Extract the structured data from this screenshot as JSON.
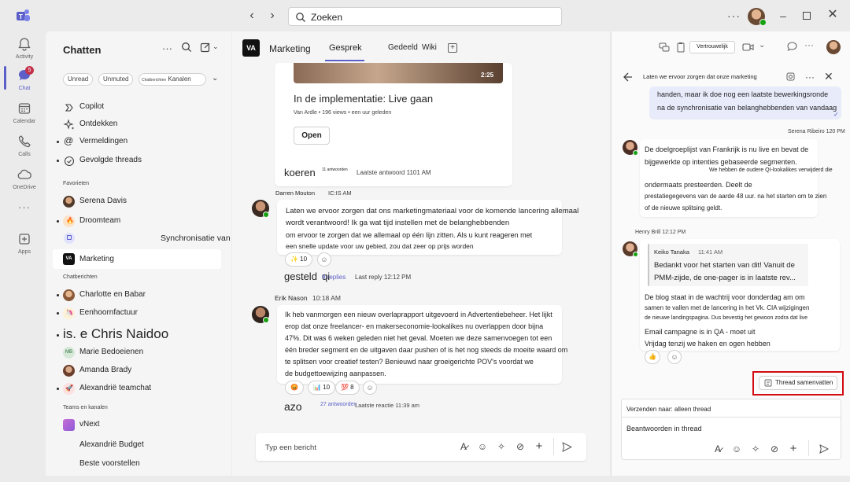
{
  "titlebar": {
    "search_placeholder": "Zoeken",
    "more": "···"
  },
  "rail": {
    "items": [
      {
        "label": "Activity",
        "icon": "bell-icon"
      },
      {
        "label": "Chat",
        "icon": "chat-icon",
        "badge": "5"
      },
      {
        "label": "Calendar",
        "icon": "calendar-icon"
      },
      {
        "label": "Calls",
        "icon": "phone-icon"
      },
      {
        "label": "OneDrive",
        "icon": "cloud-icon"
      },
      {
        "label": "···",
        "icon": "more-icon"
      },
      {
        "label": "Apps",
        "icon": "apps-icon"
      }
    ]
  },
  "chatlist": {
    "title": "Chatten",
    "more": "···",
    "filters": [
      "Unread",
      "Unmuted",
      "Chatberichten",
      "Kanalen"
    ],
    "top_items": [
      {
        "label": "Copilot",
        "icon": "copilot-icon"
      },
      {
        "label": "Ontdekken",
        "icon": "sparkle-icon"
      },
      {
        "label": "Vermeldingen",
        "icon": "at-icon"
      },
      {
        "label": "Gevolgde threads",
        "icon": "thread-icon"
      }
    ],
    "favorites_header": "Favorieten",
    "favorites": [
      {
        "label": "Serena Davis"
      },
      {
        "label": "Droomteam"
      },
      {
        "label": "Synchronisatie van marketingteam"
      },
      {
        "label": "Marketing"
      }
    ],
    "chats_header": "Chatberichten",
    "chats": [
      {
        "label": "Charlotte en Babar"
      },
      {
        "label": "Eenhoornfactuur"
      },
      {
        "label": "is. e Chris Naidoo"
      },
      {
        "label": "Marie Bedoeienen",
        "initials": "MB"
      },
      {
        "label": "Amanda Brady"
      },
      {
        "label": "Alexandrië teamchat"
      }
    ],
    "teams_header": "Teams en kanalen",
    "teams": [
      {
        "label": "vNext"
      },
      {
        "label": "Alexandrië Budget"
      },
      {
        "label": "Beste voorstellen"
      }
    ]
  },
  "main": {
    "team_logo": "VA",
    "team_name": "Marketing",
    "tabs": [
      "Gesprek",
      "Gedeeld",
      "Wiki"
    ],
    "card": {
      "duration": "2:25",
      "title": "In de implementatie: Live gaan",
      "subtitle": "Van Ardle • 196 views • een uur geleden",
      "button": "Open"
    },
    "reply1": {
      "name": "koeren",
      "count": "11 antwoorden",
      "last": "Laatste antwoord 1101 AM"
    },
    "post2": {
      "author": "Darren Mouton",
      "time": "IC:IS AM",
      "lines": [
        "Laten we ervoor zorgen dat ons marketingmateriaal voor de komende lancering allemaal",
        "wordt verantwoord! Ik ga wat tijd instellen met de belanghebbenden",
        "om ervoor te zorgen dat we allemaal op één lijn zitten. Als u kunt reageren met",
        "een snelle update voor uw gebied, zou dat zeer op prijs worden"
      ],
      "reaction": "✨ 10"
    },
    "reply2": {
      "name": "gesteld",
      "extra": "qi",
      "count": "9 replies",
      "last": "Last reply 12:12 PM"
    },
    "post3": {
      "author": "Erik Nason",
      "time": "10:18 AM",
      "lines": [
        "Ik heb vanmorgen een nieuw overlaprapport uitgevoerd in Advertentiebeheer. Het lijkt",
        "erop dat onze freelancer- en makerseconomie-lookalikes nu overlappen door bijna",
        "47%. Dit was 6 weken geleden niet het geval. Moeten we deze samenvoegen tot een",
        "één breder segment en de uitgaven daar pushen of is het nog steeds de moeite waard om",
        "te splitsen voor creatief testen? Benieuwd naar groeigerichte POV's voordat we",
        "de budgettoewijzing aanpassen."
      ],
      "reactions": [
        "😡",
        "📊 10",
        "💯 8"
      ]
    },
    "reply3": {
      "name": "azo",
      "count": "27 antwoorden",
      "last": "Laatste reactie 11:39 am"
    },
    "compose_placeholder": "Typ een bericht"
  },
  "thread": {
    "title": "Laten we ervoor zorgen dat onze marketing",
    "more": "···",
    "my_msg_lines": [
      "handen, maar ik doe nog een laatste bewerkingsronde",
      "na de synchronisatie van belanghebbenden van vandaag"
    ],
    "msg1_meta": "Serena Ribeiro 120 PM",
    "msg1_lines": [
      "De doelgroeplijst van Frankrijk is nu live en bevat de",
      "bijgewerkte op intenties gebaseerde segmenten.",
      "We hebben de oudere QI-lookalikes verwijderd die",
      "ondermaats presteerden. Deelt de",
      "prestatiegegevens van de aarde 48 uur. na het starten om te zien",
      "of de nieuwe splitsing geldt."
    ],
    "msg2_meta": "Henry Brill 12:12 PM",
    "quote_author": "Keiko Tanaka",
    "quote_time": "11:41 AM",
    "quote_lines": [
      "Bedankt voor het starten van dit! Vanuit de",
      "PMM-zijde, de one-pager is in laatste rev..."
    ],
    "msg2_lines": [
      "De blog staat in de wachtrij voor donderdag am om",
      "samen te vallen met de lancering in het Vk. CIA wijzigingen",
      "de nieuwe landingspagina.  Dus bevestig het gewoon zodra dat live",
      "Email campagne is in QA - moet uit",
      "Vrijdag tenzij we haken en ogen hebben"
    ],
    "msg2_reaction": "👍",
    "summarize_button": "Thread samenvatten",
    "send_to": "Verzenden naar: alleen thread",
    "reply_placeholder": "Beantwoorden in thread"
  },
  "colors": {
    "accent": "#5b5fc7",
    "highlight": "#d20a11",
    "presence": "#13a10e"
  }
}
